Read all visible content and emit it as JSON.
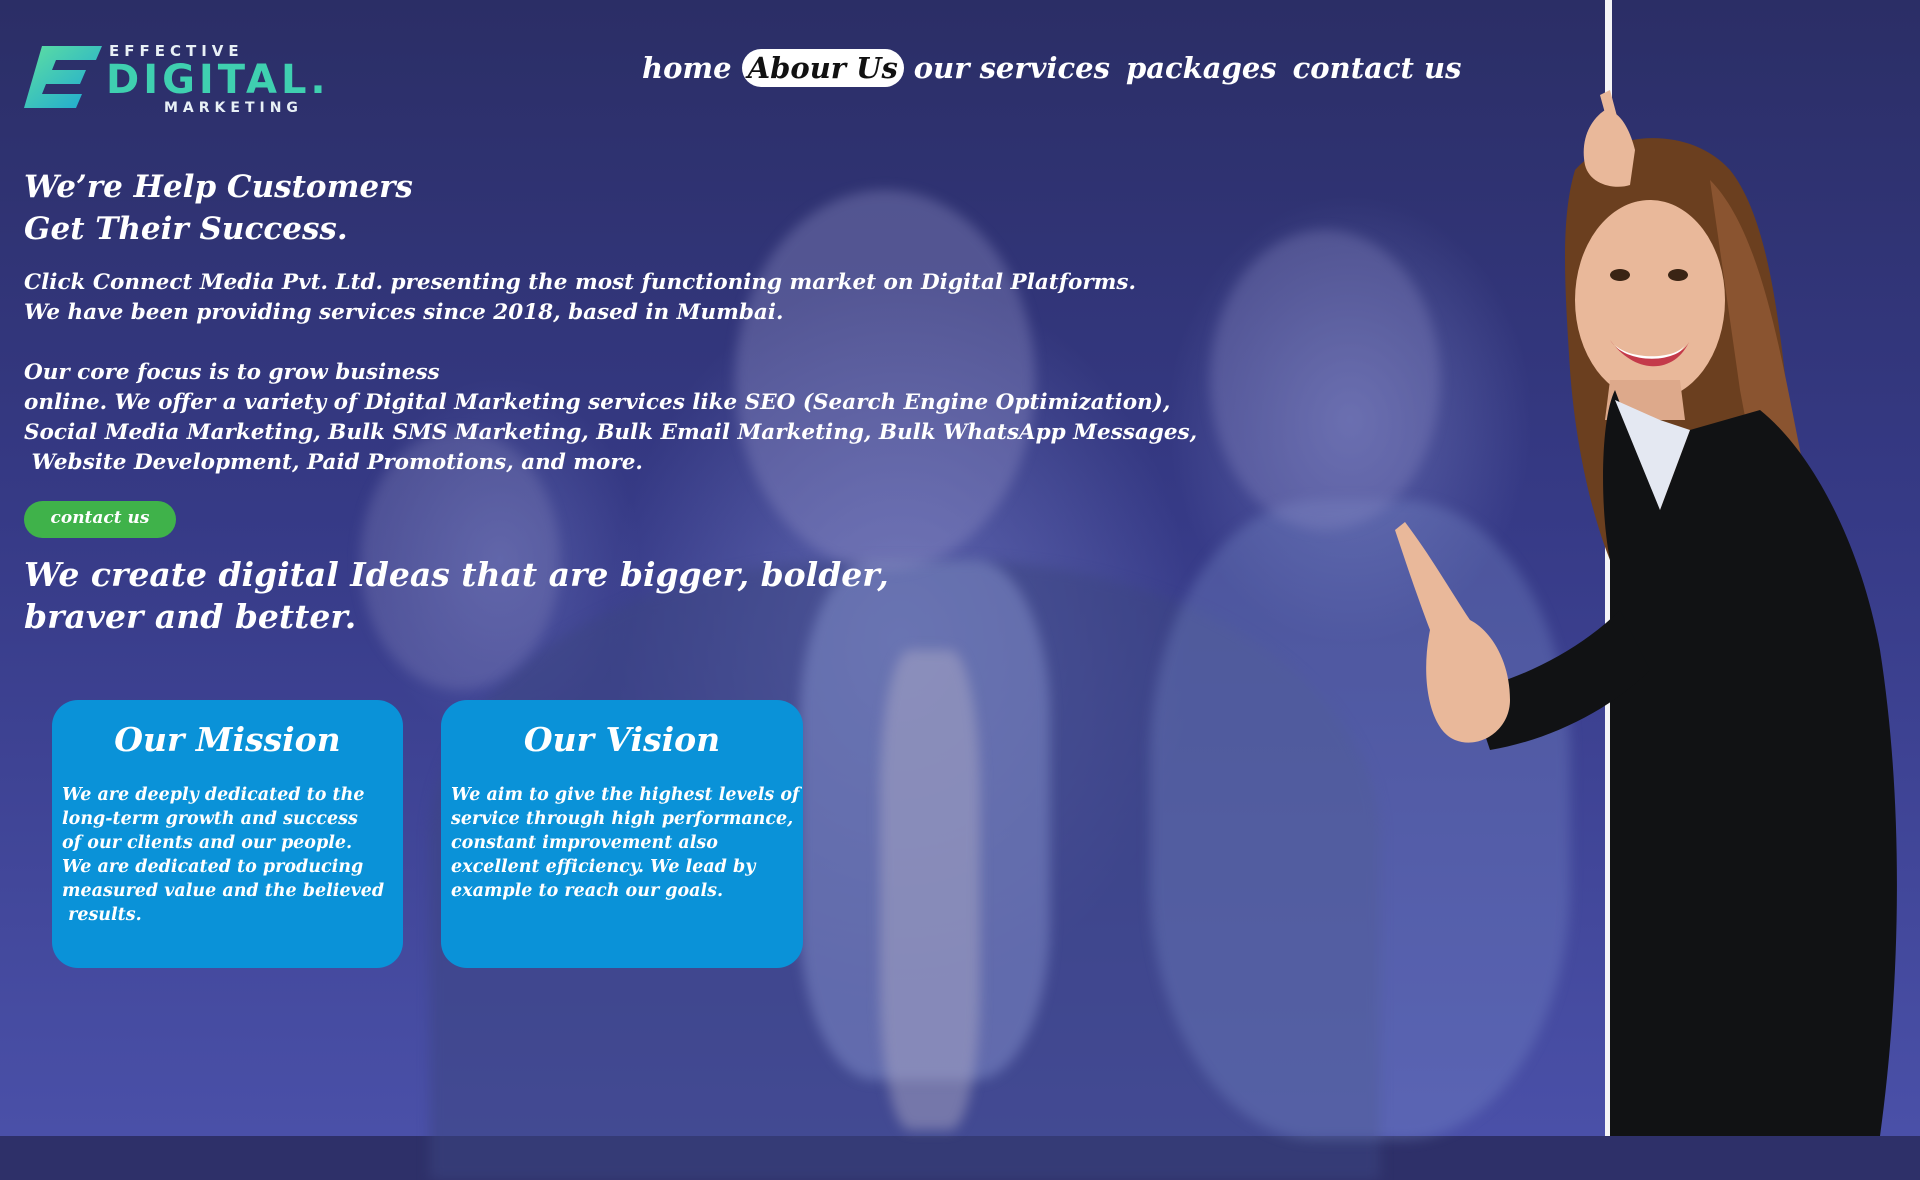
{
  "logo": {
    "top": "EFFECTIVE",
    "mid": "DIGITAL.",
    "bottom": "MARKETING"
  },
  "nav": {
    "items": [
      "home",
      "Abour Us",
      "our services",
      "packages",
      "contact us"
    ],
    "active_index": 1
  },
  "hero": {
    "headline_line1": "We’re Help Customers",
    "headline_line2": "Get Their Success.",
    "intro": "Click Connect Media Pvt. Ltd. presenting the most functioning market on Digital Platforms.\nWe have been providing services since 2018, based in Mumbai.\n\nOur core focus is to grow business\nonline. We offer a variety of Digital Marketing services like SEO (Search Engine Optimization),\nSocial Media Marketing, Bulk SMS Marketing, Bulk Email Marketing, Bulk WhatsApp Messages,\n Website Development, Paid Promotions, and more.",
    "cta_label": "contact us",
    "tagline_line1": "We create digital Ideas that are bigger, bolder,",
    "tagline_line2": "braver and better."
  },
  "cards": {
    "mission": {
      "title": "Our Mission",
      "text": "We are deeply dedicated to the\nlong-term growth and success\nof our clients and our people.\nWe are dedicated to producing\nmeasured value and the believed\n results."
    },
    "vision": {
      "title": "Our Vision",
      "text": "We aim to give the highest levels of\nservice through high performance,\nconstant improvement also\nexcellent efficiency. We lead by\nexample to reach our goals."
    }
  },
  "colors": {
    "background": "#2e3069",
    "card": "#0a92d8",
    "cta": "#3fb24a",
    "logo_accent": "#3fd0b0"
  }
}
